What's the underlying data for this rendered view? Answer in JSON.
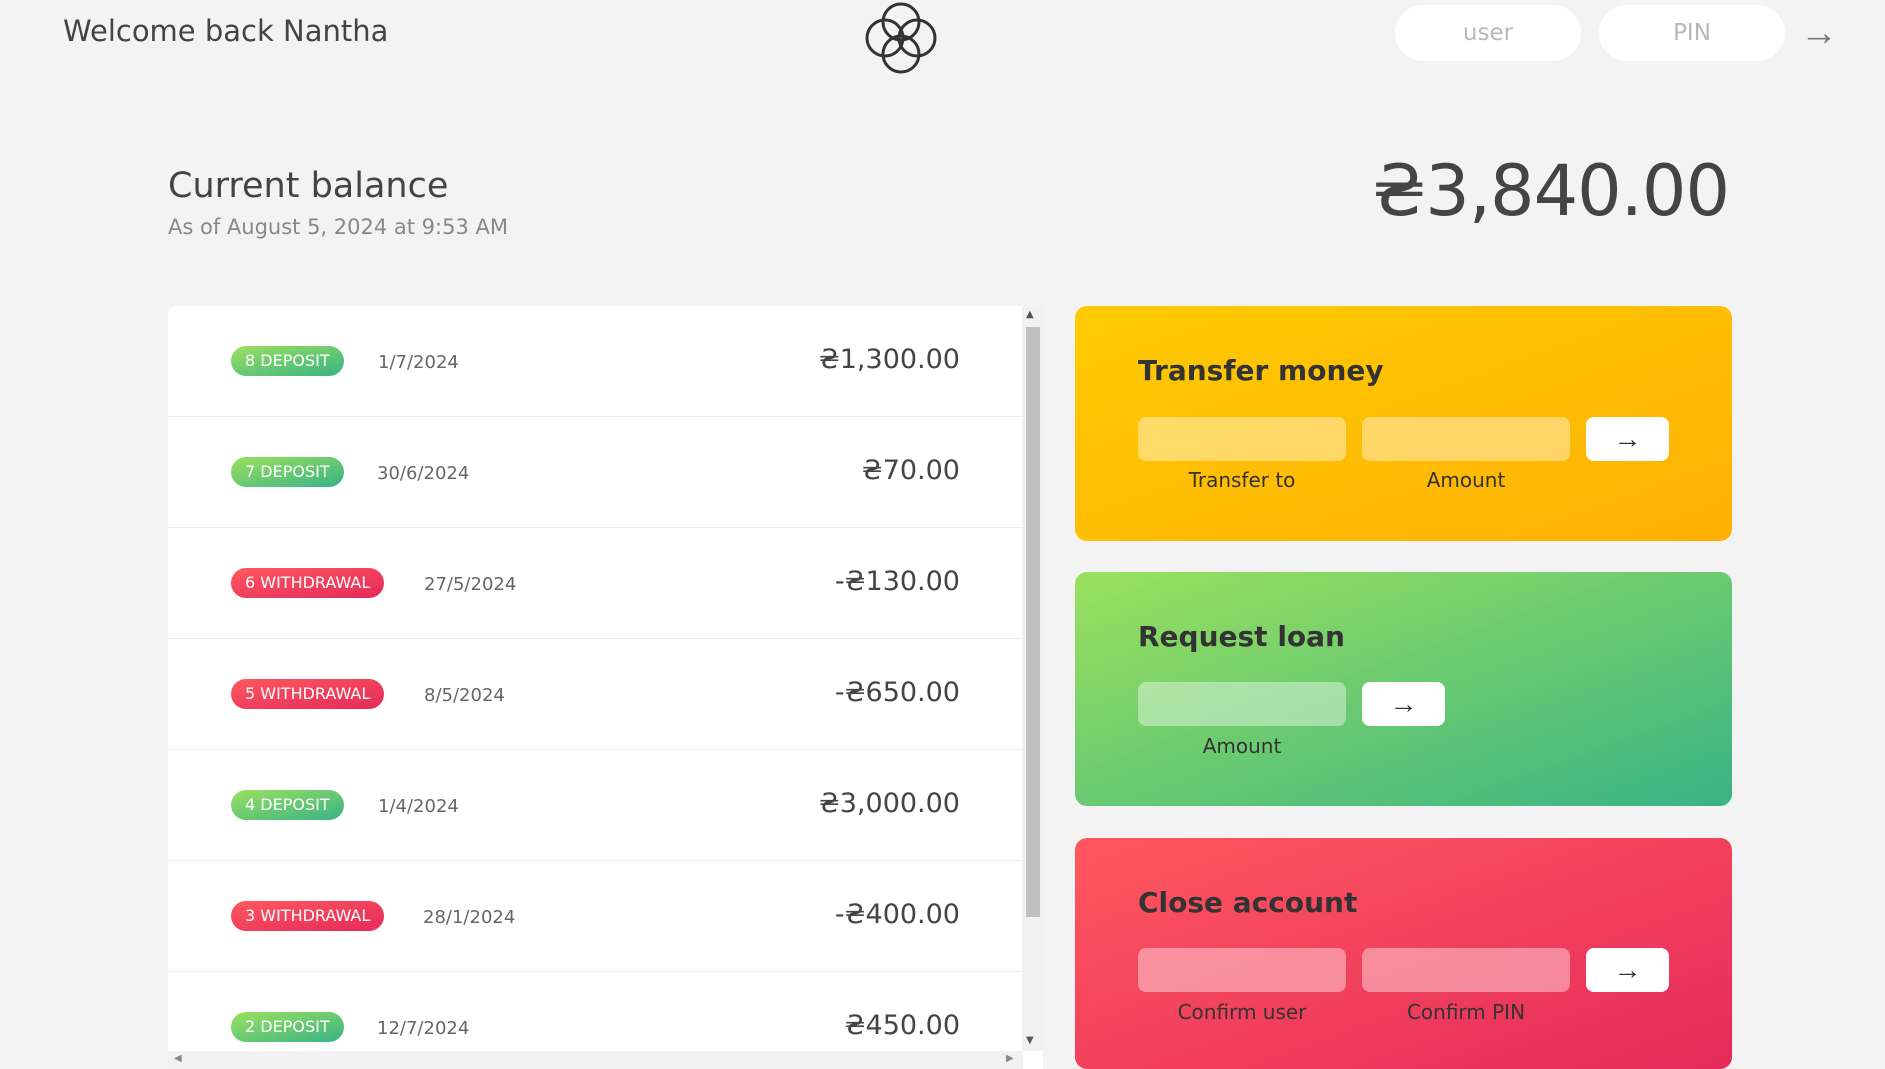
{
  "nav": {
    "welcome": "Welcome back Nantha",
    "user_placeholder": "user",
    "pin_placeholder": "PIN",
    "login_button": "→"
  },
  "balance": {
    "label": "Current balance",
    "date": "As of August 5, 2024 at 9:53 AM",
    "value": "₴3,840.00"
  },
  "movements": [
    {
      "type": "8 DEPOSIT",
      "kind": "deposit",
      "date": "1/7/2024",
      "value": "₴1,300.00"
    },
    {
      "type": "7 DEPOSIT",
      "kind": "deposit",
      "date": "30/6/2024",
      "value": "₴70.00"
    },
    {
      "type": "6 WITHDRAWAL",
      "kind": "withdrawal",
      "date": "27/5/2024",
      "value": "-₴130.00"
    },
    {
      "type": "5 WITHDRAWAL",
      "kind": "withdrawal",
      "date": "8/5/2024",
      "value": "-₴650.00"
    },
    {
      "type": "4 DEPOSIT",
      "kind": "deposit",
      "date": "1/4/2024",
      "value": "₴3,000.00"
    },
    {
      "type": "3 WITHDRAWAL",
      "kind": "withdrawal",
      "date": "28/1/2024",
      "value": "-₴400.00"
    },
    {
      "type": "2 DEPOSIT",
      "kind": "deposit",
      "date": "12/7/2024",
      "value": "₴450.00"
    }
  ],
  "operations": {
    "transfer": {
      "title": "Transfer money",
      "to_label": "Transfer to",
      "amount_label": "Amount",
      "button": "→"
    },
    "loan": {
      "title": "Request loan",
      "amount_label": "Amount",
      "button": "→"
    },
    "close": {
      "title": "Close account",
      "user_label": "Confirm user",
      "pin_label": "Confirm PIN",
      "button": "→"
    }
  },
  "colors": {
    "deposit": "#39b385",
    "withdrawal": "#e52a5a",
    "transfer": "#ffcb03",
    "loan": "#9be15d",
    "close": "#ff585f"
  }
}
